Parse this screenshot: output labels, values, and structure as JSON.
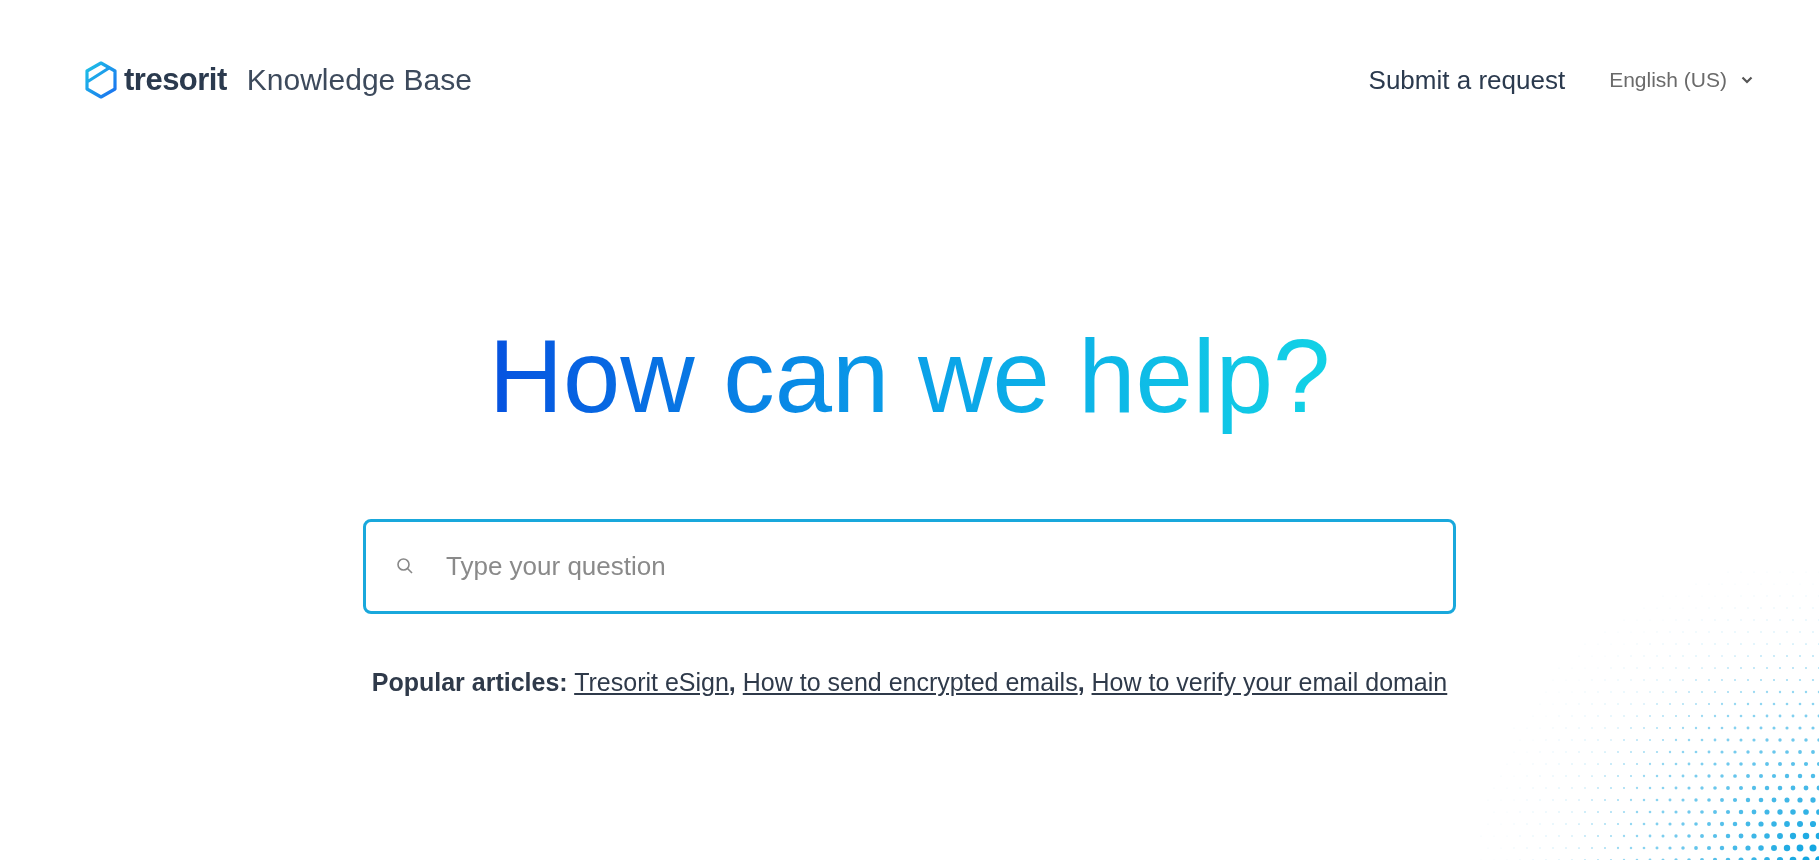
{
  "header": {
    "brand": "tresorit",
    "title": "Knowledge Base"
  },
  "nav": {
    "submit": "Submit a request",
    "language": "English (US)"
  },
  "hero": {
    "heading": "How can we help?"
  },
  "search": {
    "placeholder": "Type your question"
  },
  "popular": {
    "label": "Popular articles:",
    "separator": ",",
    "articles": [
      {
        "title": "Tresorit eSign"
      },
      {
        "title": "How to send encrypted emails"
      },
      {
        "title": "How to verify your email domain"
      }
    ]
  }
}
